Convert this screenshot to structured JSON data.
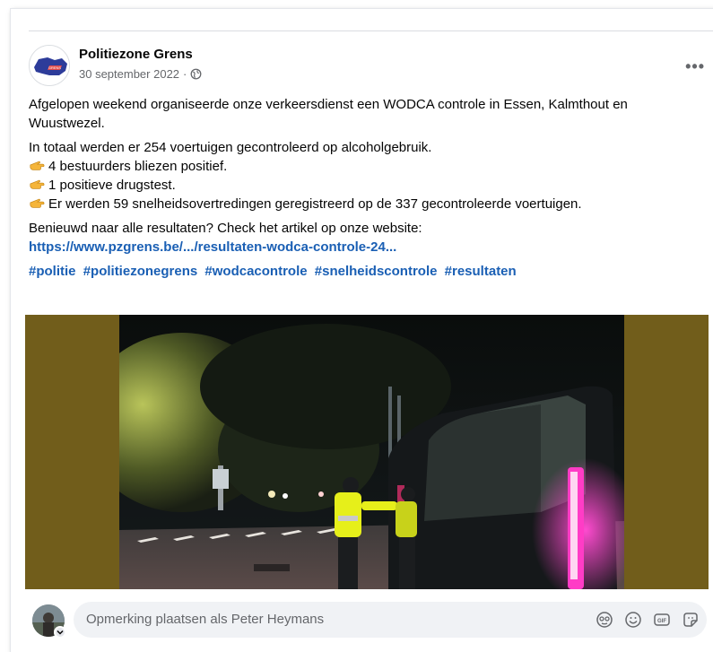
{
  "post": {
    "author": "Politiezone Grens",
    "date": "30 september 2022",
    "date_separator": "·",
    "more_label": "•••",
    "logo_text": "GRENS",
    "paragraph1": "Afgelopen weekend organiseerde onze verkeersdienst een WODCA controle in Essen, Kalmthout en Wuustwezel.",
    "paragraph2_line1": "In totaal werden er 254 voertuigen gecontroleerd op alcoholgebruik.",
    "bullets": [
      "4 bestuurders bliezen positief.",
      "1 positieve drugstest.",
      "Er werden 59 snelheidsovertredingen geregistreerd op de 337 gecontroleerde voertuigen."
    ],
    "paragraph3": "Benieuwd naar alle resultaten? Check het artikel op onze website:",
    "link": "https://www.pzgrens.be/.../resultaten-wodca-controle-24...",
    "hashtags": [
      "#politie",
      "#politiezonegrens",
      "#wodcacontrole",
      "#snelheidscontrole",
      "#resultaten"
    ]
  },
  "comment": {
    "placeholder": "Opmerking plaatsen als Peter Heymans",
    "icons": [
      "sticker-face-icon",
      "emoji-icon",
      "gif-icon",
      "sticker-icon"
    ]
  },
  "colors": {
    "link": "#1a5fb4",
    "secondary_text": "#65676b",
    "media_background": "#715d1b",
    "comment_background": "#f0f2f5"
  }
}
